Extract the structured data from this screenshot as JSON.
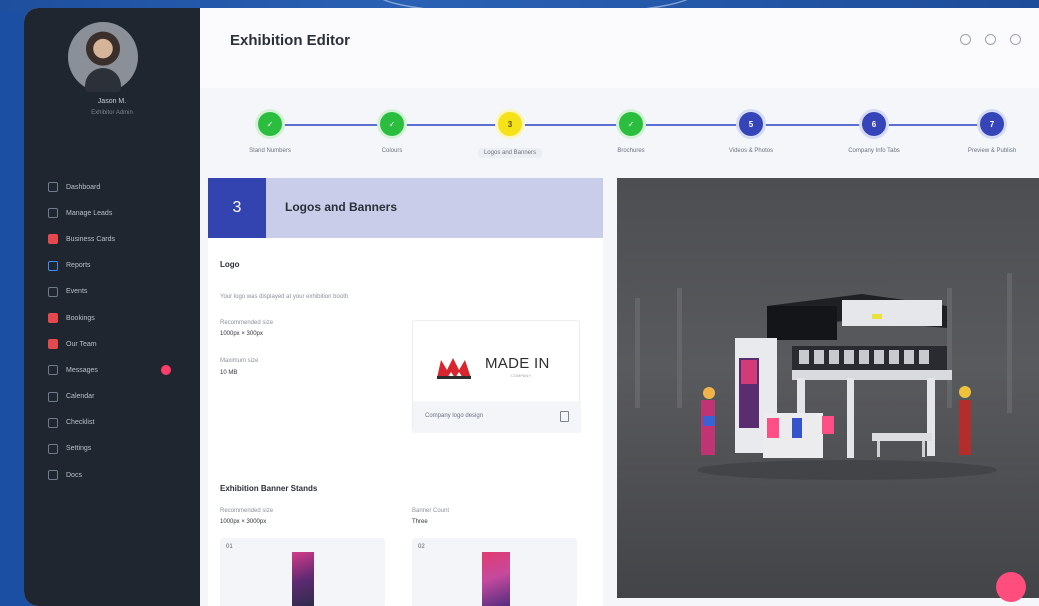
{
  "header": {
    "title": "Exhibition Editor",
    "icons": [
      "wrench-icon",
      "gear-icon",
      "bell-icon"
    ]
  },
  "sidebar": {
    "user_name": "Jason M.",
    "user_role": "Exhibitor Admin",
    "items": [
      {
        "label": "Dashboard",
        "icon": "grid-icon"
      },
      {
        "label": "Manage Leads",
        "icon": "users-icon"
      },
      {
        "label": "Business Cards",
        "icon": "card-icon"
      },
      {
        "label": "Reports",
        "icon": "chart-icon"
      },
      {
        "label": "Events",
        "icon": "calendar-icon"
      },
      {
        "label": "Bookings",
        "icon": "ticket-icon"
      },
      {
        "label": "Our Team",
        "icon": "team-icon"
      },
      {
        "label": "Messages",
        "icon": "chat-icon",
        "badge": true
      },
      {
        "label": "Calendar",
        "icon": "calendar-icon"
      },
      {
        "label": "Checklist",
        "icon": "check-icon"
      },
      {
        "label": "Settings",
        "icon": "gear-icon"
      },
      {
        "label": "Docs",
        "icon": "doc-icon"
      }
    ]
  },
  "stepper": {
    "steps": [
      {
        "label": "Stand Numbers",
        "status": "done"
      },
      {
        "label": "Colours",
        "status": "done"
      },
      {
        "label": "Logos and Banners",
        "status": "current",
        "number": "3"
      },
      {
        "label": "Brochures",
        "status": "done"
      },
      {
        "label": "Videos & Photos",
        "status": "pending",
        "number": "5"
      },
      {
        "label": "Company Info Tabs",
        "status": "pending",
        "number": "6"
      },
      {
        "label": "Preview & Publish",
        "status": "pending",
        "number": "7"
      }
    ]
  },
  "panel": {
    "number": "3",
    "title": "Logos and Banners",
    "logo": {
      "title": "Logo",
      "description": "Your logo was displayed at your exhibition booth",
      "dims_label": "Recommended size",
      "dims_value": "1000px × 300px",
      "file_label": "Maximum size",
      "file_value": "10 MB",
      "brand_text": "MADE IN",
      "brand_sub": "COMPANY",
      "file_name": "Company logo design"
    },
    "banners": {
      "title": "Exhibition Banner Stands",
      "dims_label": "Recommended size",
      "dims_value": "1000px × 3000px",
      "count_label": "Banner Count",
      "count_value": "Three",
      "items": [
        "01",
        "02"
      ]
    }
  },
  "colors": {
    "sidebar": "#1f262f",
    "accent": "#3344b0",
    "done": "#2bbd3e",
    "current": "#f5e218",
    "badge": "#ff3d6a"
  }
}
